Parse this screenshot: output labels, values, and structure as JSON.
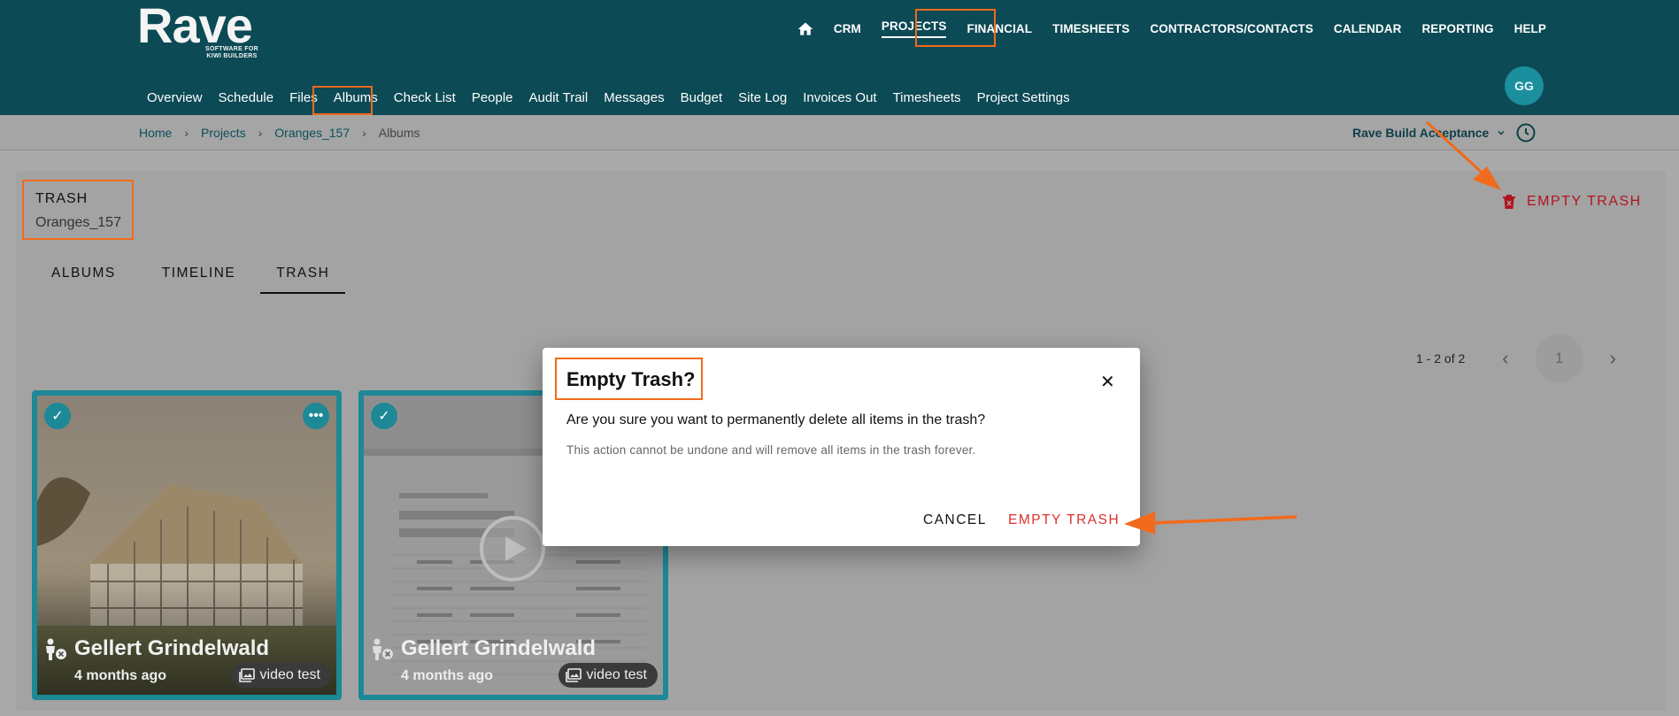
{
  "brand": {
    "name": "Rave",
    "tagline_line1": "SOFTWARE FOR",
    "tagline_line2": "KIWI BUILDERS"
  },
  "main_nav": {
    "home_icon": "home-icon",
    "items": [
      "CRM",
      "PROJECTS",
      "FINANCIAL",
      "TIMESHEETS",
      "CONTRACTORS/CONTACTS",
      "CALENDAR",
      "REPORTING",
      "HELP"
    ],
    "active": "PROJECTS"
  },
  "sub_nav": {
    "items": [
      "Overview",
      "Schedule",
      "Files",
      "Albums",
      "Check List",
      "People",
      "Audit Trail",
      "Messages",
      "Budget",
      "Site Log",
      "Invoices Out",
      "Timesheets",
      "Project Settings"
    ],
    "active": "Albums"
  },
  "user": {
    "initials": "GG"
  },
  "breadcrumb": {
    "items": [
      "Home",
      "Projects",
      "Oranges_157"
    ],
    "current": "Albums",
    "separator": "›"
  },
  "company_selector": {
    "value": "Rave Build Acceptance"
  },
  "page": {
    "title": "TRASH",
    "subtitle": "Oranges_157",
    "empty_trash_label": "EMPTY TRASH"
  },
  "tabs": [
    "ALBUMS",
    "TIMELINE",
    "TRASH"
  ],
  "active_tab": "TRASH",
  "pagination": {
    "range": "1 - 2 of 2",
    "current_page": "1"
  },
  "cards": [
    {
      "name": "Gellert Grindelwald",
      "age": "4 months ago",
      "album": "video test"
    },
    {
      "name": "Gellert Grindelwald",
      "age": "4 months ago",
      "album": "video test"
    }
  ],
  "dialog": {
    "title": "Empty Trash?",
    "question": "Are you sure you want to permanently delete all items in the trash?",
    "note": "This action cannot be undone and will remove all items in the trash forever.",
    "cancel_label": "CANCEL",
    "confirm_label": "EMPTY TRASH"
  },
  "colors": {
    "header": "#0c4a55",
    "accent": "#1d8896",
    "danger": "#d9322f",
    "annotation": "#f26a1b"
  }
}
